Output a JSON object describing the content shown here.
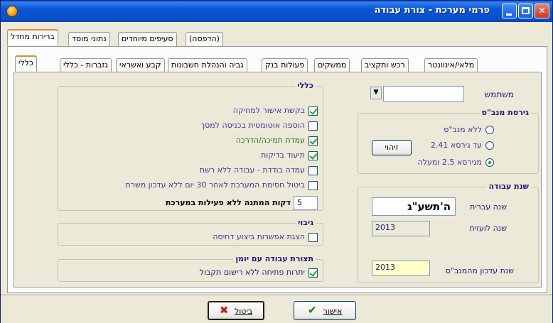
{
  "window": {
    "title": "פרמי מערכת - צורת עבודה"
  },
  "tabs_top": [
    {
      "label": "ברירות מחדל",
      "active": true
    },
    {
      "label": "נתוני מוסד"
    },
    {
      "label": "סעיפים מיוחדים"
    },
    {
      "label": "(הדפסה)"
    }
  ],
  "tabs_sub": [
    {
      "label": "כללי",
      "active": true
    },
    {
      "label": "גזברות - כללי"
    },
    {
      "label": "קבע ואשראי"
    },
    {
      "label": "גביה והנהלת חשבונות"
    },
    {
      "label": "פעולות בנק"
    },
    {
      "label": "ממשקים"
    },
    {
      "label": "רכש ותקציב"
    },
    {
      "label": "מלאי/אינוונטר"
    }
  ],
  "general": {
    "title": "כללי",
    "items": [
      {
        "label": "בקשת אישור למחיקה",
        "checked": true,
        "color": "#3a3a9a"
      },
      {
        "label": "הוספה אוטומטית בכניסה למסך",
        "checked": false,
        "color": "#3a3a9a"
      },
      {
        "label": "עמדת תמיכה/הדרכה",
        "checked": true,
        "color": "#1b7a1b"
      },
      {
        "label": "תיעוד בדיקות",
        "checked": true,
        "color": "#3a3a9a"
      },
      {
        "label": "עמדה בודדת - עבודה ללא רשת",
        "checked": false,
        "color": "#3a3a9a"
      },
      {
        "label": "ביטול חסימת המערכת לאחר 30 יום ללא עדכון משרת",
        "checked": false,
        "color": "#3a3a9a"
      }
    ],
    "idle_minutes_value": "5",
    "idle_minutes_label": "דקות המתנה ללא פעילות במערכת"
  },
  "backup": {
    "title": "גיבוי",
    "item_label": "הצגת אפשרות ביצוע דחיסה",
    "checked": false
  },
  "diary": {
    "title": "תצורת עבודה עם יומן",
    "item_label": "יתרות פתיחה ללא רישום תקבול",
    "checked": true
  },
  "user": {
    "label": "משתמש",
    "value": ""
  },
  "manbas": {
    "title": "גירסת מנב\"ס",
    "options": [
      {
        "label": "ללא מנב\"ס",
        "checked": false
      },
      {
        "label": "עד גירסא 2.41",
        "checked": false
      },
      {
        "label": "מגירסא 2.5 ומעלה",
        "checked": true
      }
    ],
    "identify_button": "זיהוי"
  },
  "work_year": {
    "title": "שנת עבודה",
    "hebrew_label": "שנה עברית",
    "hebrew_value": "ה'תשע\"ג",
    "gregorian_label": "שנה לועזית",
    "gregorian_value": "2013",
    "update_label": "שנת עדכון מהמנב\"ס",
    "update_value": "2013"
  },
  "buttons": {
    "cancel": "ביטול",
    "ok": "אישור"
  }
}
